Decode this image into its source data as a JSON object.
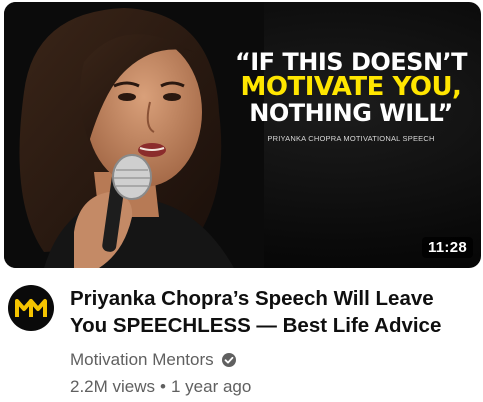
{
  "video": {
    "duration": "11:28",
    "thumbnail_text": {
      "line1": "“IF THIS DOESN’T",
      "line2": "MOTIVATE YOU,",
      "line3": "NOTHING WILL”",
      "subtitle": "PRIYANKA CHOPRA MOTIVATIONAL SPEECH"
    },
    "title": "Priyanka Chopra’s Speech Will Leave You SPEECHLESS — Best Life Advice",
    "channel": "Motivation Mentors",
    "views": "2.2M views",
    "separator": "•",
    "age": "1 year ago"
  },
  "colors": {
    "highlight": "#ffe600",
    "avatar_logo": "#f5c400",
    "meta_text": "#606060",
    "title_text": "#0f0f0f"
  },
  "icons": {
    "avatar": "mm-logo-icon",
    "verified": "check-circle-icon"
  }
}
